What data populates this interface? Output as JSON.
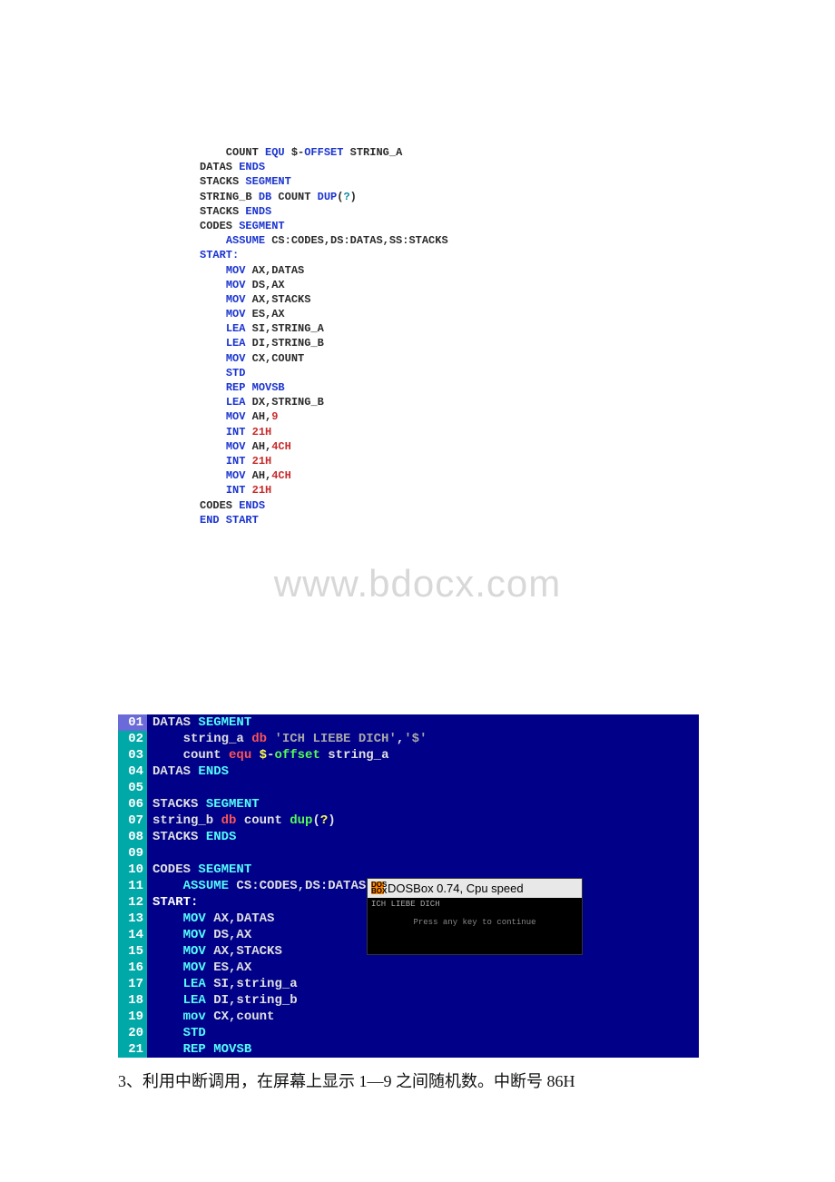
{
  "code1": {
    "lines": [
      [
        [
          "    COUNT ",
          "plain"
        ],
        [
          "EQU",
          "blue"
        ],
        [
          " $-",
          "plain"
        ],
        [
          "OFFSET",
          "blue"
        ],
        [
          " STRING_A",
          "plain"
        ]
      ],
      [
        [
          "DATAS ",
          "plain"
        ],
        [
          "ENDS",
          "blue"
        ]
      ],
      [
        [
          "",
          "plain"
        ]
      ],
      [
        [
          "STACKS ",
          "plain"
        ],
        [
          "SEGMENT",
          "blue"
        ]
      ],
      [
        [
          "STRING_B ",
          "plain"
        ],
        [
          "DB",
          "blue"
        ],
        [
          " COUNT ",
          "plain"
        ],
        [
          "DUP",
          "blue"
        ],
        [
          "(",
          "plain"
        ],
        [
          "?",
          "cyan-dir"
        ],
        [
          ")",
          "plain"
        ]
      ],
      [
        [
          "STACKS ",
          "plain"
        ],
        [
          "ENDS",
          "blue"
        ]
      ],
      [
        [
          "",
          "plain"
        ]
      ],
      [
        [
          "CODES ",
          "plain"
        ],
        [
          "SEGMENT",
          "blue"
        ]
      ],
      [
        [
          "    ",
          "plain"
        ],
        [
          "ASSUME",
          "blue"
        ],
        [
          " CS:CODES,DS:DATAS,SS:STACKS",
          "plain"
        ]
      ],
      [
        [
          "START:",
          "blue"
        ]
      ],
      [
        [
          "    ",
          "plain"
        ],
        [
          "MOV",
          "blue"
        ],
        [
          " AX,DATAS",
          "plain"
        ]
      ],
      [
        [
          "    ",
          "plain"
        ],
        [
          "MOV",
          "blue"
        ],
        [
          " DS,AX",
          "plain"
        ]
      ],
      [
        [
          "    ",
          "plain"
        ],
        [
          "MOV",
          "blue"
        ],
        [
          " AX,STACKS",
          "plain"
        ]
      ],
      [
        [
          "    ",
          "plain"
        ],
        [
          "MOV",
          "blue"
        ],
        [
          " ES,AX",
          "plain"
        ]
      ],
      [
        [
          "    ",
          "plain"
        ],
        [
          "LEA",
          "blue"
        ],
        [
          " SI,STRING_A",
          "plain"
        ]
      ],
      [
        [
          "    ",
          "plain"
        ],
        [
          "LEA",
          "blue"
        ],
        [
          " DI,STRING_B",
          "plain"
        ]
      ],
      [
        [
          "    ",
          "plain"
        ],
        [
          "MOV",
          "blue"
        ],
        [
          " CX,COUNT",
          "plain"
        ]
      ],
      [
        [
          "    ",
          "plain"
        ],
        [
          "STD",
          "blue"
        ]
      ],
      [
        [
          "    ",
          "plain"
        ],
        [
          "REP",
          "blue"
        ],
        [
          " ",
          "plain"
        ],
        [
          "MOVSB",
          "blue"
        ]
      ],
      [
        [
          "    ",
          "plain"
        ],
        [
          "LEA",
          "blue"
        ],
        [
          " DX,STRING_B",
          "plain"
        ]
      ],
      [
        [
          "    ",
          "plain"
        ],
        [
          "MOV",
          "blue"
        ],
        [
          " AH,",
          "plain"
        ],
        [
          "9",
          "num"
        ]
      ],
      [
        [
          "    ",
          "plain"
        ],
        [
          "INT",
          "blue"
        ],
        [
          " ",
          "plain"
        ],
        [
          "21H",
          "num"
        ]
      ],
      [
        [
          "    ",
          "plain"
        ],
        [
          "MOV",
          "blue"
        ],
        [
          " AH,",
          "plain"
        ],
        [
          "4CH",
          "num"
        ]
      ],
      [
        [
          "    ",
          "plain"
        ],
        [
          "INT",
          "blue"
        ],
        [
          " ",
          "plain"
        ],
        [
          "21H",
          "num"
        ]
      ],
      [
        [
          "",
          "plain"
        ]
      ],
      [
        [
          "    ",
          "plain"
        ],
        [
          "MOV",
          "blue"
        ],
        [
          " AH,",
          "plain"
        ],
        [
          "4CH",
          "num"
        ]
      ],
      [
        [
          "    ",
          "plain"
        ],
        [
          "INT",
          "blue"
        ],
        [
          " ",
          "plain"
        ],
        [
          "21H",
          "num"
        ]
      ],
      [
        [
          "CODES ",
          "plain"
        ],
        [
          "ENDS",
          "blue"
        ]
      ],
      [
        [
          "END",
          "blue"
        ],
        [
          " START",
          "blue"
        ]
      ]
    ]
  },
  "watermark": "www.bdocx.com",
  "editor": {
    "active_line": 1,
    "rows": [
      {
        "n": "01",
        "tokens": [
          [
            "DATAS ",
            "kw-wht"
          ],
          [
            "SEGMENT",
            "kw-seg"
          ]
        ]
      },
      {
        "n": "02",
        "tokens": [
          [
            "    string_a ",
            "kw-wht"
          ],
          [
            "db",
            "kw-db"
          ],
          [
            " ",
            "kw-wht"
          ],
          [
            "'ICH LIEBE DICH'",
            "kw-str"
          ],
          [
            ",",
            "kw-wht"
          ],
          [
            "'$'",
            "kw-str"
          ]
        ]
      },
      {
        "n": "03",
        "tokens": [
          [
            "    count ",
            "kw-wht"
          ],
          [
            "equ",
            "kw-equ"
          ],
          [
            " ",
            "kw-wht"
          ],
          [
            "$",
            "kw-sym"
          ],
          [
            "-",
            "kw-wht"
          ],
          [
            "offset",
            "kw-gr"
          ],
          [
            " string_a",
            "kw-wht"
          ]
        ]
      },
      {
        "n": "04",
        "tokens": [
          [
            "DATAS ",
            "kw-wht"
          ],
          [
            "ENDS",
            "kw-seg"
          ]
        ]
      },
      {
        "n": "05",
        "tokens": [
          [
            "",
            "kw-wht"
          ]
        ]
      },
      {
        "n": "06",
        "tokens": [
          [
            "STACKS ",
            "kw-wht"
          ],
          [
            "SEGMENT",
            "kw-seg"
          ]
        ]
      },
      {
        "n": "07",
        "tokens": [
          [
            "string_b ",
            "kw-wht"
          ],
          [
            "db",
            "kw-db"
          ],
          [
            " count ",
            "kw-wht"
          ],
          [
            "dup",
            "kw-gr"
          ],
          [
            "(",
            "kw-wht"
          ],
          [
            "?",
            "kw-sym"
          ],
          [
            ")",
            "kw-wht"
          ]
        ]
      },
      {
        "n": "08",
        "tokens": [
          [
            "STACKS ",
            "kw-wht"
          ],
          [
            "ENDS",
            "kw-seg"
          ]
        ]
      },
      {
        "n": "09",
        "tokens": [
          [
            "",
            "kw-wht"
          ]
        ]
      },
      {
        "n": "10",
        "tokens": [
          [
            "CODES ",
            "kw-wht"
          ],
          [
            "SEGMENT",
            "kw-seg"
          ]
        ]
      },
      {
        "n": "11",
        "tokens": [
          [
            "    ",
            "kw-wht"
          ],
          [
            "ASSUME",
            "kw-op"
          ],
          [
            " CS:CODES,DS:DATAS,SS:STACKS",
            "kw-wht"
          ]
        ]
      },
      {
        "n": "12",
        "tokens": [
          [
            "START:",
            "kw-lbl"
          ]
        ]
      },
      {
        "n": "13",
        "tokens": [
          [
            "    ",
            "kw-wht"
          ],
          [
            "MOV",
            "kw-op"
          ],
          [
            " AX,DATAS",
            "kw-wht"
          ]
        ]
      },
      {
        "n": "14",
        "tokens": [
          [
            "    ",
            "kw-wht"
          ],
          [
            "MOV",
            "kw-op"
          ],
          [
            " DS,AX",
            "kw-wht"
          ]
        ]
      },
      {
        "n": "15",
        "tokens": [
          [
            "    ",
            "kw-wht"
          ],
          [
            "MOV",
            "kw-op"
          ],
          [
            " AX,STACKS",
            "kw-wht"
          ]
        ]
      },
      {
        "n": "16",
        "tokens": [
          [
            "    ",
            "kw-wht"
          ],
          [
            "MOV",
            "kw-op"
          ],
          [
            " ES,AX",
            "kw-wht"
          ]
        ]
      },
      {
        "n": "17",
        "tokens": [
          [
            "    ",
            "kw-wht"
          ],
          [
            "LEA",
            "kw-op"
          ],
          [
            " SI,string_a",
            "kw-wht"
          ]
        ]
      },
      {
        "n": "18",
        "tokens": [
          [
            "    ",
            "kw-wht"
          ],
          [
            "LEA",
            "kw-op"
          ],
          [
            " DI,string_b",
            "kw-wht"
          ]
        ]
      },
      {
        "n": "19",
        "tokens": [
          [
            "    ",
            "kw-wht"
          ],
          [
            "mov",
            "kw-op"
          ],
          [
            " CX,count",
            "kw-wht"
          ]
        ]
      },
      {
        "n": "20",
        "tokens": [
          [
            "    ",
            "kw-wht"
          ],
          [
            "STD",
            "kw-op"
          ]
        ]
      },
      {
        "n": "21",
        "tokens": [
          [
            "    ",
            "kw-wht"
          ],
          [
            "REP",
            "kw-op"
          ],
          [
            " ",
            "kw-wht"
          ],
          [
            "MOVSB",
            "kw-op"
          ]
        ]
      }
    ]
  },
  "dosbox": {
    "title": "DOSBox 0.74, Cpu speed",
    "output": "ICH LIEBE DICH",
    "press": "Press any key to continue"
  },
  "caption": "3、利用中断调用，在屏幕上显示 1—9 之间随机数。中断号 86H"
}
